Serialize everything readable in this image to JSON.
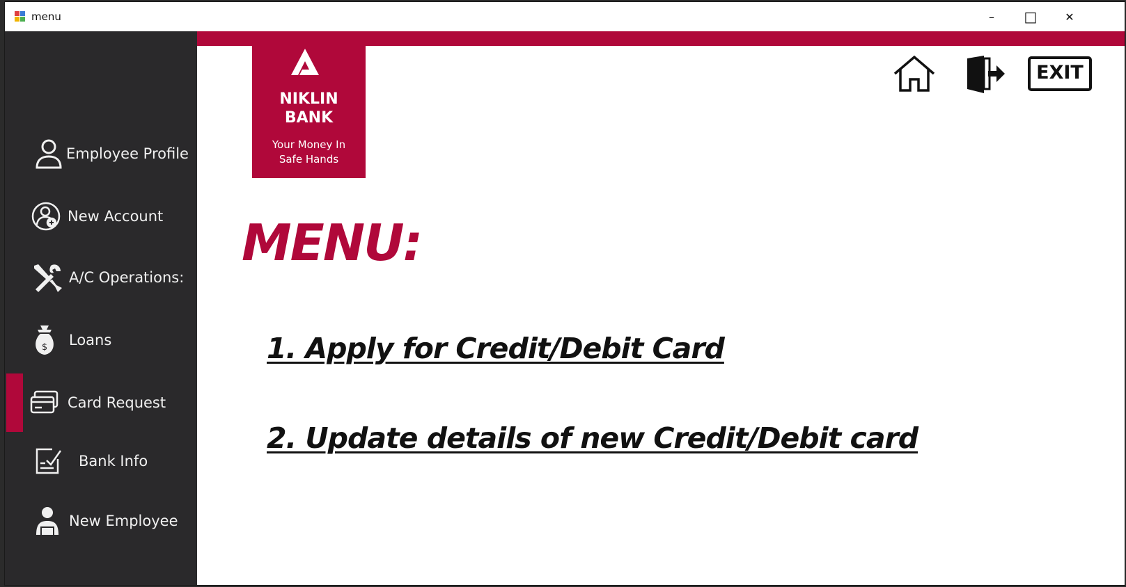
{
  "window": {
    "title": "menu",
    "controls": {
      "minimize": "–",
      "maximize": "□",
      "close": "✕"
    }
  },
  "colors": {
    "accent": "#b0083a",
    "sidebar_bg": "#2a292b",
    "sidebar_text": "#f0f0f0"
  },
  "sidebar": {
    "items": [
      {
        "label": "Employee Profile",
        "icon": "user-icon"
      },
      {
        "label": "New Account",
        "icon": "user-add-icon"
      },
      {
        "label": "A/C Operations:",
        "icon": "tools-icon"
      },
      {
        "label": "Loans",
        "icon": "money-bag-icon"
      },
      {
        "label": "Card Request",
        "icon": "card-icon",
        "active": true
      },
      {
        "label": "Bank Info",
        "icon": "checklist-icon"
      },
      {
        "label": "New Employee",
        "icon": "employee-icon"
      }
    ]
  },
  "logo": {
    "name_line1": "NIKLIN",
    "name_line2": "BANK",
    "tagline_line1": "Your Money In",
    "tagline_line2": "Safe Hands"
  },
  "toolbar": {
    "home": "home-icon",
    "logout": "logout-icon",
    "exit_label": "EXIT"
  },
  "main": {
    "title": "MENU:",
    "options": [
      "1. Apply for Credit/Debit Card",
      "2. Update details of new Credit/Debit card"
    ]
  }
}
